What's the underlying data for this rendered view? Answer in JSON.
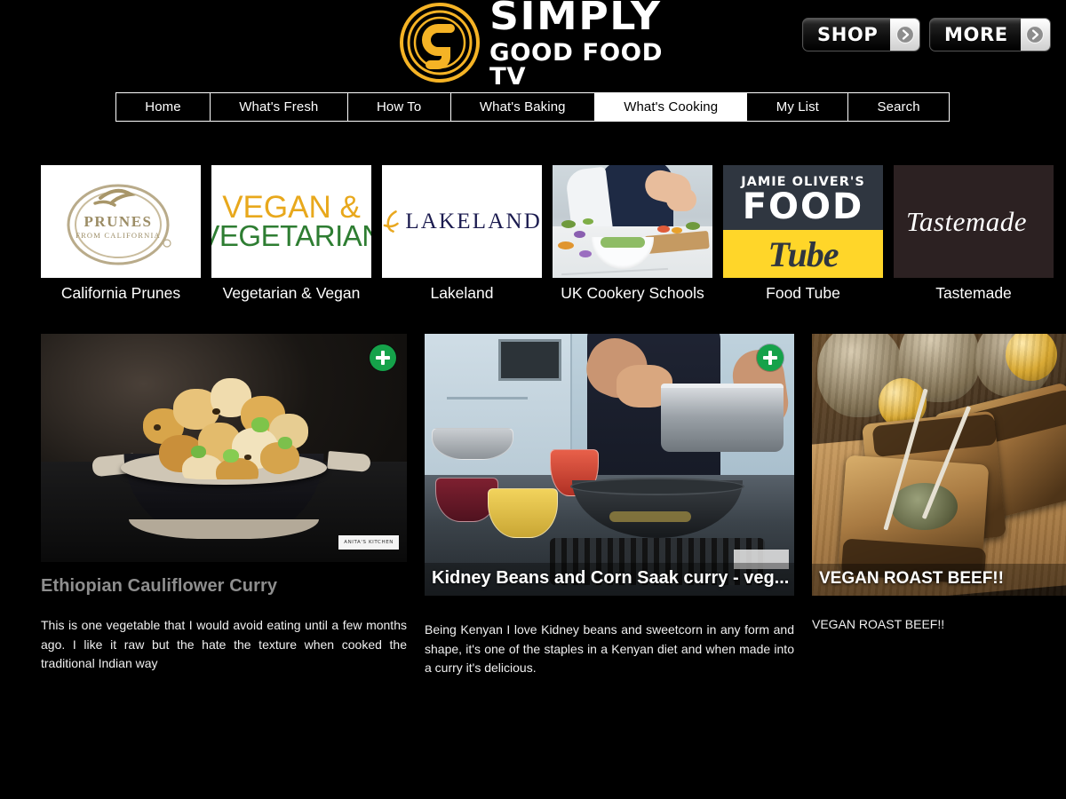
{
  "header": {
    "logo": {
      "line1": "SIMPLY",
      "line2": "GOOD FOOD TV",
      "mark": "g-circle-logo"
    },
    "shop_label": "SHOP",
    "more_label": "MORE"
  },
  "nav": {
    "items": [
      {
        "label": "Home",
        "active": false
      },
      {
        "label": "What's Fresh",
        "active": false
      },
      {
        "label": "How To",
        "active": false
      },
      {
        "label": "What's Baking",
        "active": false
      },
      {
        "label": "What's Cooking",
        "active": true
      },
      {
        "label": "My List",
        "active": false
      },
      {
        "label": "Search",
        "active": false
      }
    ]
  },
  "brands": [
    {
      "name": "California Prunes",
      "logo_text": "PRUNES FROM CALIFORNIA"
    },
    {
      "name": "Vegetarian & Vegan",
      "logo_line1": "VEGAN &",
      "logo_line2": "VEGETARIAN"
    },
    {
      "name": "Lakeland",
      "logo_text": "LAKELAND"
    },
    {
      "name": "UK Cookery Schools",
      "logo_text": ""
    },
    {
      "name": "Food Tube",
      "logo_line1": "JAMIE OLIVER'S",
      "logo_line2": "FOOD",
      "logo_line3": "Tube"
    },
    {
      "name": "Tastemade",
      "logo_text": "Tastemade"
    }
  ],
  "cards": [
    {
      "title": "Ethiopian Cauliflower Curry",
      "title_position": "below",
      "description": "This is one vegetable that I would avoid eating until a few months ago. I like it raw but the hate the texture when cooked the traditional Indian way",
      "watermark": "ANITA'S KITCHEN",
      "has_add_button": true,
      "add_button_label": "+"
    },
    {
      "title": "Kidney Beans and Corn Saak curry - veg...",
      "title_position": "overlay",
      "description": "Being Kenyan I love Kidney beans and sweetcorn in any form and shape, it's one of the staples in a Kenyan diet and when made into a curry it's delicious.",
      "watermark": "",
      "has_add_button": true,
      "add_button_label": "+"
    },
    {
      "title": "VEGAN ROAST BEEF!!",
      "title_position": "overlay",
      "description": "VEGAN ROAST BEEF!!",
      "watermark": "",
      "has_add_button": false,
      "add_button_label": ""
    }
  ],
  "colors": {
    "background": "#000000",
    "logo_gold": "#f5b325",
    "add_button_green": "#15a24a",
    "active_tab_bg": "#ffffff",
    "title_grey": "#8e8e8e",
    "food_tube_yellow": "#ffd629"
  }
}
